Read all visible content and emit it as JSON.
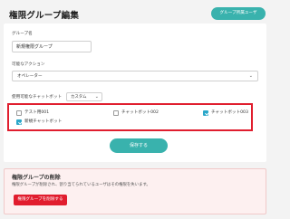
{
  "header": {
    "title": "権限グループ編集",
    "top_button": "グループ所属ユーザ"
  },
  "form": {
    "group_name_label": "グループ名",
    "group_name_value": "新規権限グループ",
    "action_label": "可能なアクション",
    "action_value": "オペレーター",
    "chatbot_label": "使用可能なチャットボット",
    "chatbot_mode": "カスタム",
    "bots": [
      {
        "label": "テスト用001",
        "checked": false
      },
      {
        "label": "チャットボット002",
        "checked": false
      },
      {
        "label": "チャットボット003",
        "checked": true
      },
      {
        "label": "新規チャットボット",
        "checked": true
      }
    ],
    "save_label": "保存する"
  },
  "danger": {
    "title": "権限グループの削除",
    "description": "権限グループが削除され、割り当てられているユーザはその権限を失います。",
    "delete_label": "権限グループを削除する"
  },
  "colors": {
    "accent": "#39b2ad",
    "danger": "#e11d2e",
    "highlight_border": "#e01e2e",
    "checkbox_on": "#2aa7c9"
  }
}
